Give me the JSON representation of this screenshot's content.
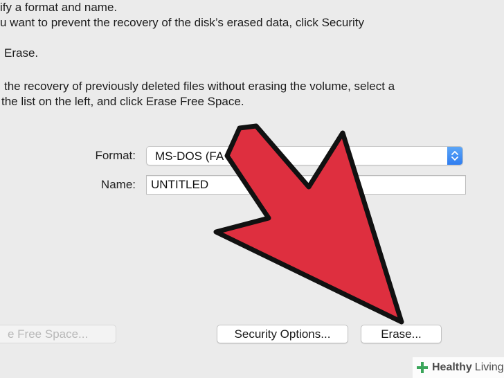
{
  "instructions": {
    "line1": "ify a format and name.",
    "line2": "u want to prevent the recovery of the disk’s erased data, click Security",
    "line3": "Erase.",
    "line4": "the recovery of previously deleted files without erasing the volume, select a",
    "line5": "the list on the left, and click Erase Free Space."
  },
  "form": {
    "format_label": "Format:",
    "format_value": "MS-DOS (FA",
    "name_label": "Name:",
    "name_value": "UNTITLED"
  },
  "buttons": {
    "erase_free_space": "e Free Space...",
    "security_options": "Security Options...",
    "erase": "Erase..."
  },
  "watermark": {
    "brand": "Healthy",
    "brand2": "Living"
  },
  "colors": {
    "arrow": "#de2f3f",
    "stepper": "#3b87f2"
  }
}
